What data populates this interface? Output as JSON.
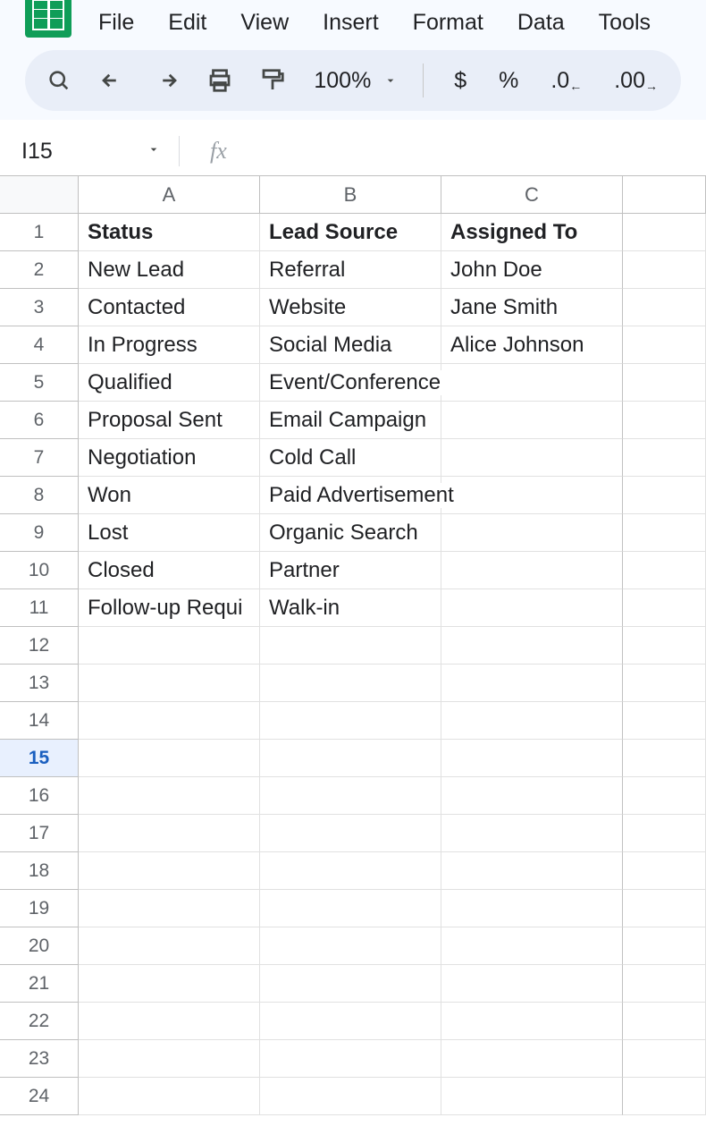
{
  "menubar": {
    "items": [
      "File",
      "Edit",
      "View",
      "Insert",
      "Format",
      "Data",
      "Tools"
    ]
  },
  "toolbar": {
    "zoom": "100%",
    "format_currency": "$",
    "format_percent": "%",
    "format_decrease_decimal": ".0",
    "format_increase_decimal": ".00"
  },
  "name_box": "I15",
  "formula_bar_label": "fx",
  "selected_row": 15,
  "columns": [
    "A",
    "B",
    "C"
  ],
  "row_count": 24,
  "cells": {
    "A1": {
      "v": "Status",
      "bold": true
    },
    "B1": {
      "v": "Lead Source",
      "bold": true
    },
    "C1": {
      "v": "Assigned To",
      "bold": true
    },
    "A2": {
      "v": "New Lead"
    },
    "B2": {
      "v": "Referral"
    },
    "C2": {
      "v": "John Doe"
    },
    "A3": {
      "v": "Contacted"
    },
    "B3": {
      "v": "Website"
    },
    "C3": {
      "v": "Jane Smith"
    },
    "A4": {
      "v": "In Progress"
    },
    "B4": {
      "v": "Social Media"
    },
    "C4": {
      "v": "Alice Johnson"
    },
    "A5": {
      "v": "Qualified"
    },
    "B5": {
      "v": "Event/Conference",
      "overflow": true
    },
    "A6": {
      "v": "Proposal Sent"
    },
    "B6": {
      "v": "Email Campaign"
    },
    "A7": {
      "v": "Negotiation"
    },
    "B7": {
      "v": "Cold Call"
    },
    "A8": {
      "v": "Won"
    },
    "B8": {
      "v": "Paid Advertisement",
      "overflow": true
    },
    "A9": {
      "v": "Lost"
    },
    "B9": {
      "v": "Organic Search"
    },
    "A10": {
      "v": "Closed"
    },
    "B10": {
      "v": "Partner"
    },
    "A11": {
      "v": "Follow-up Requi"
    },
    "B11": {
      "v": "Walk-in"
    }
  }
}
